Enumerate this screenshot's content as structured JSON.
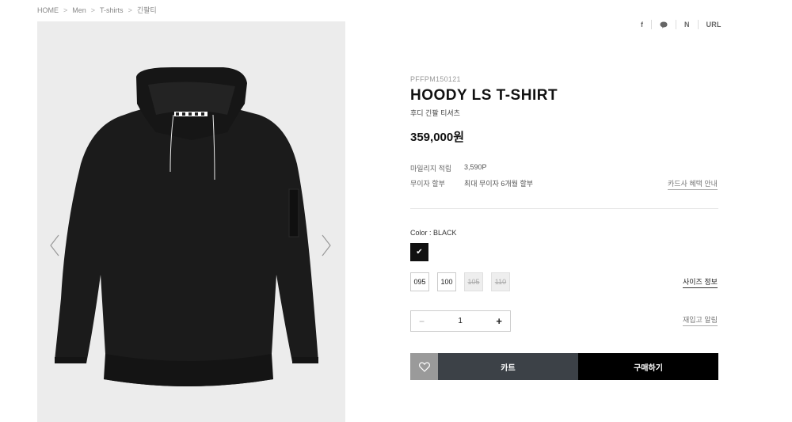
{
  "breadcrumb": {
    "items": [
      "HOME",
      "Men",
      "T-shirts",
      "긴팔티"
    ],
    "separator": ">"
  },
  "gallery": {
    "image": "black-hoodie",
    "prev_icon": "chevron-left-icon",
    "next_icon": "chevron-right-icon",
    "background": "#ececec"
  },
  "share": {
    "facebook_label": "f",
    "talk_icon": "speech-bubble-icon",
    "naver_label": "N",
    "url_label": "URL"
  },
  "product": {
    "code": "PFFPM150121",
    "name": "HOODY LS T-SHIRT",
    "name_kr": "후디 긴팔 티셔츠",
    "price": "359,000원"
  },
  "info": {
    "mileage_label": "마일리지 적립",
    "mileage_value": "3,590P",
    "installment_label": "무이자 할부",
    "installment_value": "최대 무이자 6개월 할부",
    "card_link": "카드사 혜택 안내"
  },
  "options": {
    "color_label": "Color : BLACK",
    "color_swatch": "#111111",
    "check_glyph": "✔",
    "sizes": [
      {
        "label": "095",
        "available": true
      },
      {
        "label": "100",
        "available": true
      },
      {
        "label": "105",
        "available": false
      },
      {
        "label": "110",
        "available": false
      }
    ],
    "size_guide": "사이즈 정보"
  },
  "quantity": {
    "minus": "−",
    "value": "1",
    "plus": "+",
    "restock_link": "재입고 알림"
  },
  "actions": {
    "wish_icon": "heart-icon",
    "cart_label": "카트",
    "buy_label": "구매하기",
    "colors": {
      "wish": "#9a9a9a",
      "cart": "#3c4147",
      "buy": "#000000"
    }
  }
}
